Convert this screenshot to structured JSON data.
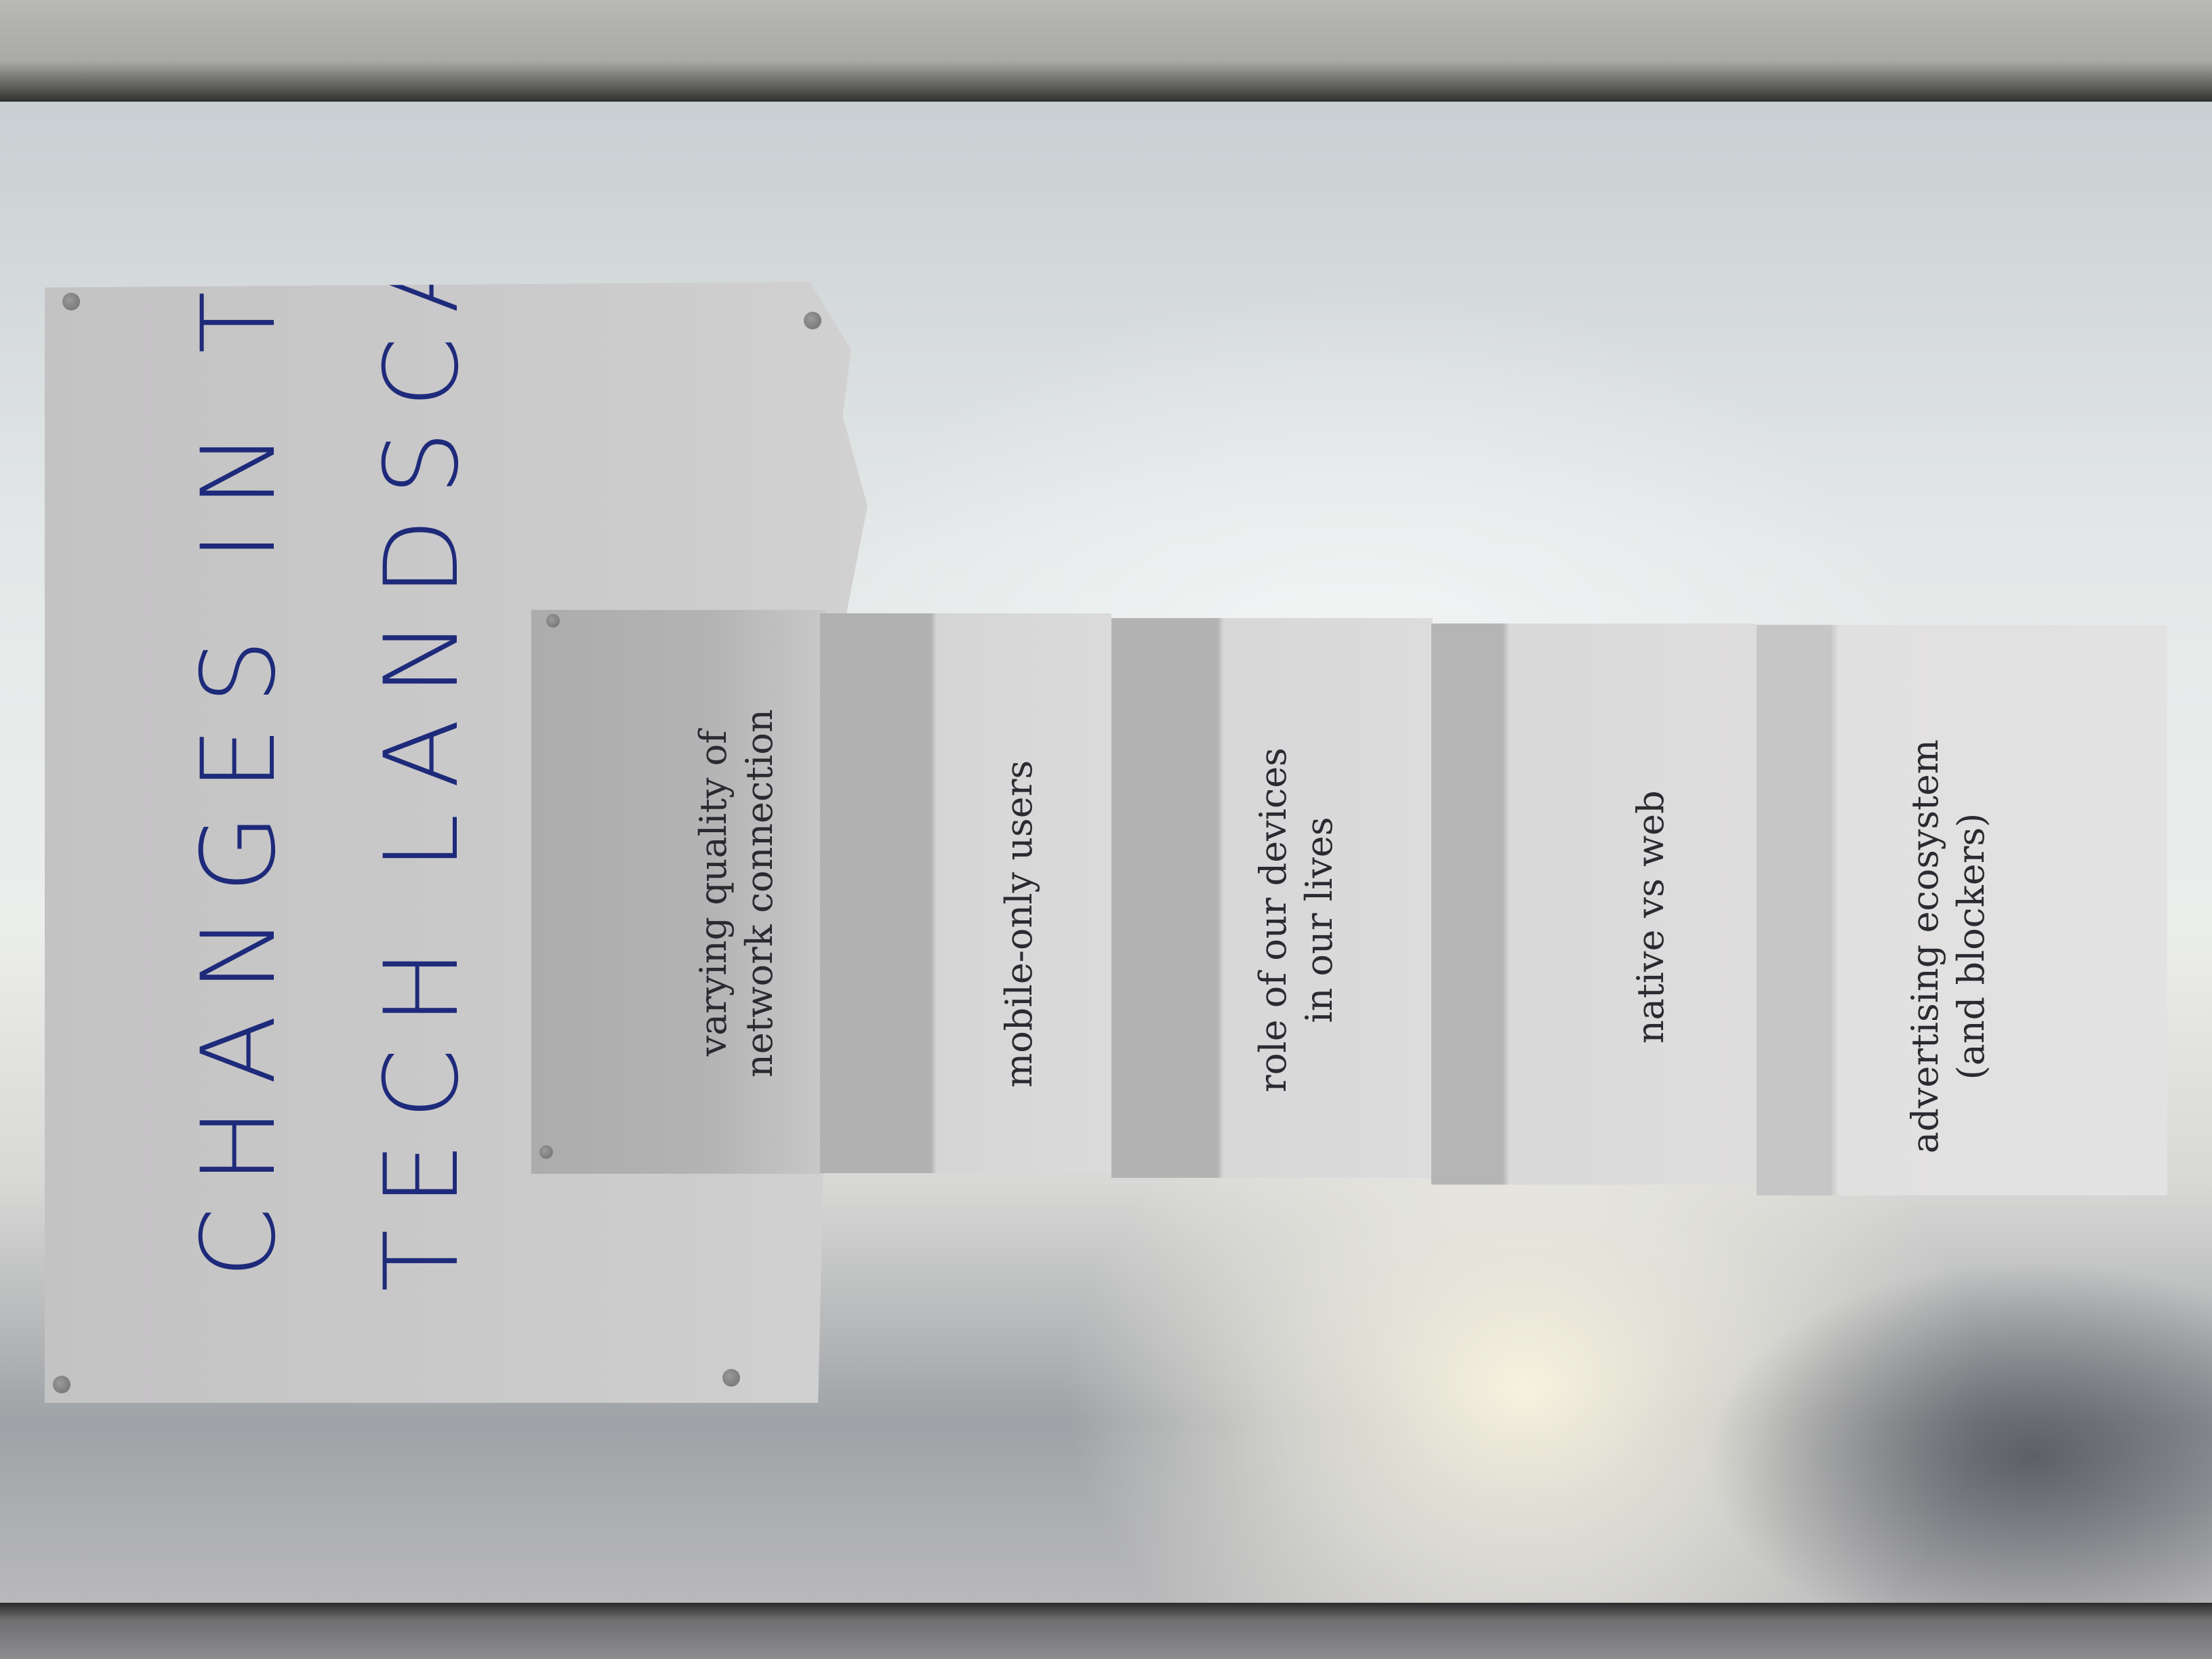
{
  "poster": {
    "heading_line_1": "CHANGES IN THE",
    "heading_line_2": "TECH LANDSCAPE"
  },
  "sheets": [
    {
      "line1": "varying quality of",
      "line2": "network connection"
    },
    {
      "line1": "mobile-only users",
      "line2": ""
    },
    {
      "line1": "role of our devices",
      "line2": "in our lives"
    },
    {
      "line1": "native vs web",
      "line2": ""
    },
    {
      "line1": "advertising ecosystem",
      "line2": "(and blockers)"
    }
  ],
  "colors": {
    "marker_ink": "#1e2a7a",
    "paper": "#dcdbdc"
  }
}
